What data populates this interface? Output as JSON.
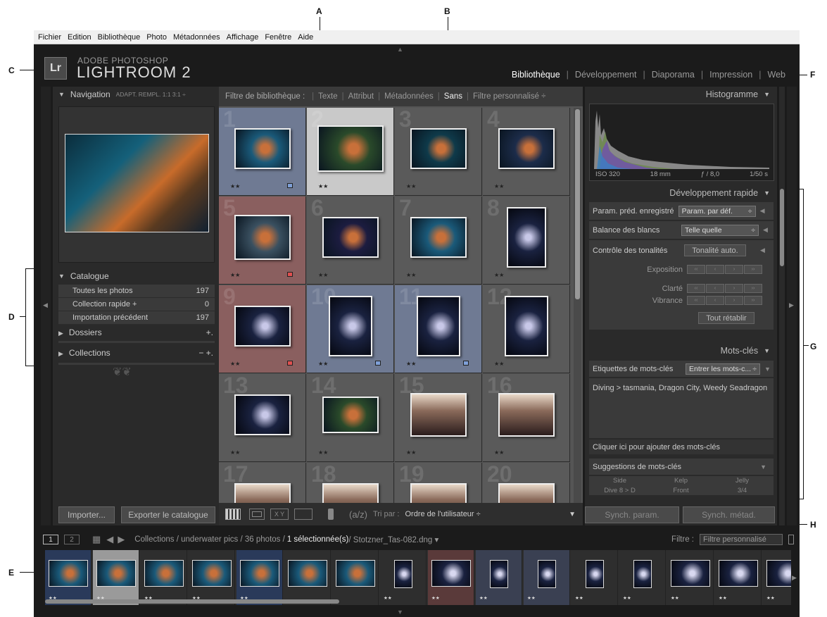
{
  "menu": [
    "Fichier",
    "Edition",
    "Bibliothèque",
    "Photo",
    "Métadonnées",
    "Affichage",
    "Fenêtre",
    "Aide"
  ],
  "brand": {
    "logo": "Lr",
    "line1": "ADOBE PHOTOSHOP",
    "line2": "LIGHTROOM 2"
  },
  "modules": [
    "Bibliothèque",
    "Développement",
    "Diaporama",
    "Impression",
    "Web"
  ],
  "active_module": "Bibliothèque",
  "callouts": [
    "A",
    "B",
    "C",
    "D",
    "E",
    "F",
    "G",
    "H"
  ],
  "left": {
    "nav_title": "Navigation",
    "nav_opts": "ADAPT.  REMPL.  1:1  3:1 ÷",
    "catalogue_title": "Catalogue",
    "catalogue": [
      {
        "label": "Toutes les photos",
        "count": "197"
      },
      {
        "label": "Collection rapide +",
        "count": "0"
      },
      {
        "label": "Importation précédent",
        "count": "197"
      }
    ],
    "dossiers": "Dossiers",
    "collections": "Collections",
    "collections_ops": "−  +.",
    "dossiers_op": "+.",
    "import_btn": "Importer...",
    "export_btn": "Exporter le catalogue"
  },
  "filter": {
    "label": "Filtre de bibliothèque :",
    "opts": [
      "Texte",
      "Attribut",
      "Métadonnées",
      "Sans"
    ],
    "active": "Sans",
    "custom": "Filtre personnalisé ÷"
  },
  "grid": {
    "cells": [
      {
        "n": "1",
        "stars": "★★",
        "flag": "#7fa0d8",
        "bg": "#6f7a93"
      },
      {
        "n": "2",
        "stars": "★★",
        "flag": "",
        "bg": "#c9c9c9"
      },
      {
        "n": "3",
        "stars": "★★",
        "flag": "",
        "bg": "#5a5a5a"
      },
      {
        "n": "4",
        "stars": "★★",
        "flag": "",
        "bg": "#5a5a5a"
      },
      {
        "n": "5",
        "stars": "★★",
        "flag": "#e05050",
        "bg": "#8a5f5f"
      },
      {
        "n": "6",
        "stars": "★★",
        "flag": "",
        "bg": "#5a5a5a"
      },
      {
        "n": "7",
        "stars": "★★",
        "flag": "",
        "bg": "#5a5a5a"
      },
      {
        "n": "8",
        "stars": "★★",
        "flag": "",
        "bg": "#5a5a5a"
      },
      {
        "n": "9",
        "stars": "★★",
        "flag": "#e05050",
        "bg": "#8a5f5f"
      },
      {
        "n": "10",
        "stars": "★★",
        "flag": "#7fa0d8",
        "bg": "#6f7a93"
      },
      {
        "n": "11",
        "stars": "★★",
        "flag": "#7fa0d8",
        "bg": "#6f7a93"
      },
      {
        "n": "12",
        "stars": "★★",
        "flag": "",
        "bg": "#5a5a5a"
      },
      {
        "n": "13",
        "stars": "★★",
        "flag": "",
        "bg": "#5a5a5a"
      },
      {
        "n": "14",
        "stars": "★★",
        "flag": "",
        "bg": "#5a5a5a"
      },
      {
        "n": "15",
        "stars": "★★",
        "flag": "",
        "bg": "#5a5a5a"
      },
      {
        "n": "16",
        "stars": "★★",
        "flag": "",
        "bg": "#5a5a5a"
      },
      {
        "n": "17",
        "stars": "",
        "flag": "",
        "bg": "#5a5a5a"
      },
      {
        "n": "18",
        "stars": "",
        "flag": "",
        "bg": "#5a5a5a"
      },
      {
        "n": "19",
        "stars": "",
        "flag": "",
        "bg": "#5a5a5a"
      },
      {
        "n": "20",
        "stars": "",
        "flag": "",
        "bg": "#5a5a5a"
      }
    ]
  },
  "toolbar": {
    "sort_label": "Tri par :",
    "sort_value": "Ordre de l'utilisateur ÷",
    "xy": "X Y"
  },
  "right": {
    "histogram": "Histogramme",
    "hist_meta": [
      "ISO 320",
      "18 mm",
      "ƒ / 8,0",
      "1/50 s"
    ],
    "quick_dev": "Développement rapide",
    "preset_label": "Param. préd. enregistré",
    "preset_value": "Param. par déf.",
    "wb_label": "Balance des blancs",
    "wb_value": "Telle quelle",
    "tone_label": "Contrôle des tonalités",
    "tone_btn": "Tonalité auto.",
    "exposure": "Exposition",
    "clarity": "Clarté",
    "vibrance": "Vibrance",
    "reset": "Tout rétablir",
    "keywords": "Mots-clés",
    "kw_tags_label": "Etiquettes de mots-clés",
    "kw_tags_value": "Entrer les mots-c...",
    "kw_text": "Diving > tasmania, Dragon City, Weedy Seadragon",
    "kw_add": "Cliquer ici pour ajouter des mots-clés",
    "kw_suggest": "Suggestions de mots-clés",
    "kw_sugg_items": [
      "Side",
      "Kelp",
      "Jelly",
      "Dive 8 > D",
      "Front",
      "3/4"
    ],
    "sync_params": "Synch. param.",
    "sync_meta": "Synch. métad."
  },
  "filmbar": {
    "screen1": "1",
    "screen2": "2",
    "path_prefix": "Collections / underwater pics / 36 photos / ",
    "path_selected": "1 sélectionnée(s)",
    "path_file": " / Stotzner_Tas-082.dng ▾",
    "filter_label": "Filtre :",
    "filter_value": "Filtre personnalisé"
  },
  "film": [
    {
      "stars": "★★"
    },
    {
      "stars": "★★"
    },
    {
      "stars": "★★"
    },
    {
      "stars": "★★"
    },
    {
      "stars": "★★"
    },
    {
      "stars": ""
    },
    {
      "stars": ""
    },
    {
      "stars": "★★"
    },
    {
      "stars": "★★"
    },
    {
      "stars": "★★"
    },
    {
      "stars": "★★"
    },
    {
      "stars": "★★"
    },
    {
      "stars": "★★"
    },
    {
      "stars": "★★"
    },
    {
      "stars": "★★"
    },
    {
      "stars": "★★"
    }
  ]
}
